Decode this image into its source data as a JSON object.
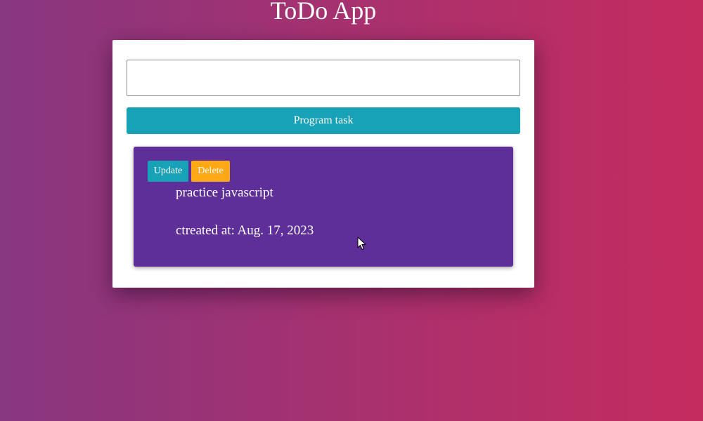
{
  "app": {
    "title": "ToDo App"
  },
  "form": {
    "task_input_value": "",
    "task_input_placeholder": "",
    "submit_label": "Program task"
  },
  "todos": [
    {
      "text": "practice javascript",
      "created": "ctreated at: Aug. 17, 2023",
      "update_label": "Update",
      "delete_label": "Delete"
    }
  ],
  "colors": {
    "background_start": "#873680",
    "background_end": "#c52c5f",
    "primary_button": "#17a2b8",
    "delete_button": "#ffa815",
    "todo_card": "#5e2f99"
  },
  "icons": {
    "cursor": "mouse-pointer-icon"
  }
}
